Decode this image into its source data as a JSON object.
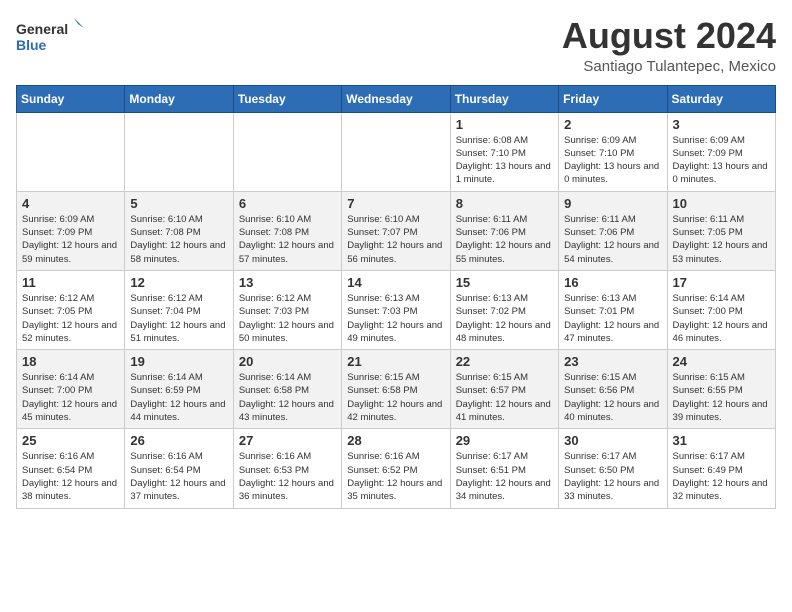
{
  "header": {
    "logo_general": "General",
    "logo_blue": "Blue",
    "month_year": "August 2024",
    "location": "Santiago Tulantepec, Mexico"
  },
  "days_of_week": [
    "Sunday",
    "Monday",
    "Tuesday",
    "Wednesday",
    "Thursday",
    "Friday",
    "Saturday"
  ],
  "weeks": [
    [
      {
        "day": "",
        "info": ""
      },
      {
        "day": "",
        "info": ""
      },
      {
        "day": "",
        "info": ""
      },
      {
        "day": "",
        "info": ""
      },
      {
        "day": "1",
        "info": "Sunrise: 6:08 AM\nSunset: 7:10 PM\nDaylight: 13 hours\nand 1 minute."
      },
      {
        "day": "2",
        "info": "Sunrise: 6:09 AM\nSunset: 7:10 PM\nDaylight: 13 hours\nand 0 minutes."
      },
      {
        "day": "3",
        "info": "Sunrise: 6:09 AM\nSunset: 7:09 PM\nDaylight: 13 hours\nand 0 minutes."
      }
    ],
    [
      {
        "day": "4",
        "info": "Sunrise: 6:09 AM\nSunset: 7:09 PM\nDaylight: 12 hours\nand 59 minutes."
      },
      {
        "day": "5",
        "info": "Sunrise: 6:10 AM\nSunset: 7:08 PM\nDaylight: 12 hours\nand 58 minutes."
      },
      {
        "day": "6",
        "info": "Sunrise: 6:10 AM\nSunset: 7:08 PM\nDaylight: 12 hours\nand 57 minutes."
      },
      {
        "day": "7",
        "info": "Sunrise: 6:10 AM\nSunset: 7:07 PM\nDaylight: 12 hours\nand 56 minutes."
      },
      {
        "day": "8",
        "info": "Sunrise: 6:11 AM\nSunset: 7:06 PM\nDaylight: 12 hours\nand 55 minutes."
      },
      {
        "day": "9",
        "info": "Sunrise: 6:11 AM\nSunset: 7:06 PM\nDaylight: 12 hours\nand 54 minutes."
      },
      {
        "day": "10",
        "info": "Sunrise: 6:11 AM\nSunset: 7:05 PM\nDaylight: 12 hours\nand 53 minutes."
      }
    ],
    [
      {
        "day": "11",
        "info": "Sunrise: 6:12 AM\nSunset: 7:05 PM\nDaylight: 12 hours\nand 52 minutes."
      },
      {
        "day": "12",
        "info": "Sunrise: 6:12 AM\nSunset: 7:04 PM\nDaylight: 12 hours\nand 51 minutes."
      },
      {
        "day": "13",
        "info": "Sunrise: 6:12 AM\nSunset: 7:03 PM\nDaylight: 12 hours\nand 50 minutes."
      },
      {
        "day": "14",
        "info": "Sunrise: 6:13 AM\nSunset: 7:03 PM\nDaylight: 12 hours\nand 49 minutes."
      },
      {
        "day": "15",
        "info": "Sunrise: 6:13 AM\nSunset: 7:02 PM\nDaylight: 12 hours\nand 48 minutes."
      },
      {
        "day": "16",
        "info": "Sunrise: 6:13 AM\nSunset: 7:01 PM\nDaylight: 12 hours\nand 47 minutes."
      },
      {
        "day": "17",
        "info": "Sunrise: 6:14 AM\nSunset: 7:00 PM\nDaylight: 12 hours\nand 46 minutes."
      }
    ],
    [
      {
        "day": "18",
        "info": "Sunrise: 6:14 AM\nSunset: 7:00 PM\nDaylight: 12 hours\nand 45 minutes."
      },
      {
        "day": "19",
        "info": "Sunrise: 6:14 AM\nSunset: 6:59 PM\nDaylight: 12 hours\nand 44 minutes."
      },
      {
        "day": "20",
        "info": "Sunrise: 6:14 AM\nSunset: 6:58 PM\nDaylight: 12 hours\nand 43 minutes."
      },
      {
        "day": "21",
        "info": "Sunrise: 6:15 AM\nSunset: 6:58 PM\nDaylight: 12 hours\nand 42 minutes."
      },
      {
        "day": "22",
        "info": "Sunrise: 6:15 AM\nSunset: 6:57 PM\nDaylight: 12 hours\nand 41 minutes."
      },
      {
        "day": "23",
        "info": "Sunrise: 6:15 AM\nSunset: 6:56 PM\nDaylight: 12 hours\nand 40 minutes."
      },
      {
        "day": "24",
        "info": "Sunrise: 6:15 AM\nSunset: 6:55 PM\nDaylight: 12 hours\nand 39 minutes."
      }
    ],
    [
      {
        "day": "25",
        "info": "Sunrise: 6:16 AM\nSunset: 6:54 PM\nDaylight: 12 hours\nand 38 minutes."
      },
      {
        "day": "26",
        "info": "Sunrise: 6:16 AM\nSunset: 6:54 PM\nDaylight: 12 hours\nand 37 minutes."
      },
      {
        "day": "27",
        "info": "Sunrise: 6:16 AM\nSunset: 6:53 PM\nDaylight: 12 hours\nand 36 minutes."
      },
      {
        "day": "28",
        "info": "Sunrise: 6:16 AM\nSunset: 6:52 PM\nDaylight: 12 hours\nand 35 minutes."
      },
      {
        "day": "29",
        "info": "Sunrise: 6:17 AM\nSunset: 6:51 PM\nDaylight: 12 hours\nand 34 minutes."
      },
      {
        "day": "30",
        "info": "Sunrise: 6:17 AM\nSunset: 6:50 PM\nDaylight: 12 hours\nand 33 minutes."
      },
      {
        "day": "31",
        "info": "Sunrise: 6:17 AM\nSunset: 6:49 PM\nDaylight: 12 hours\nand 32 minutes."
      }
    ]
  ]
}
